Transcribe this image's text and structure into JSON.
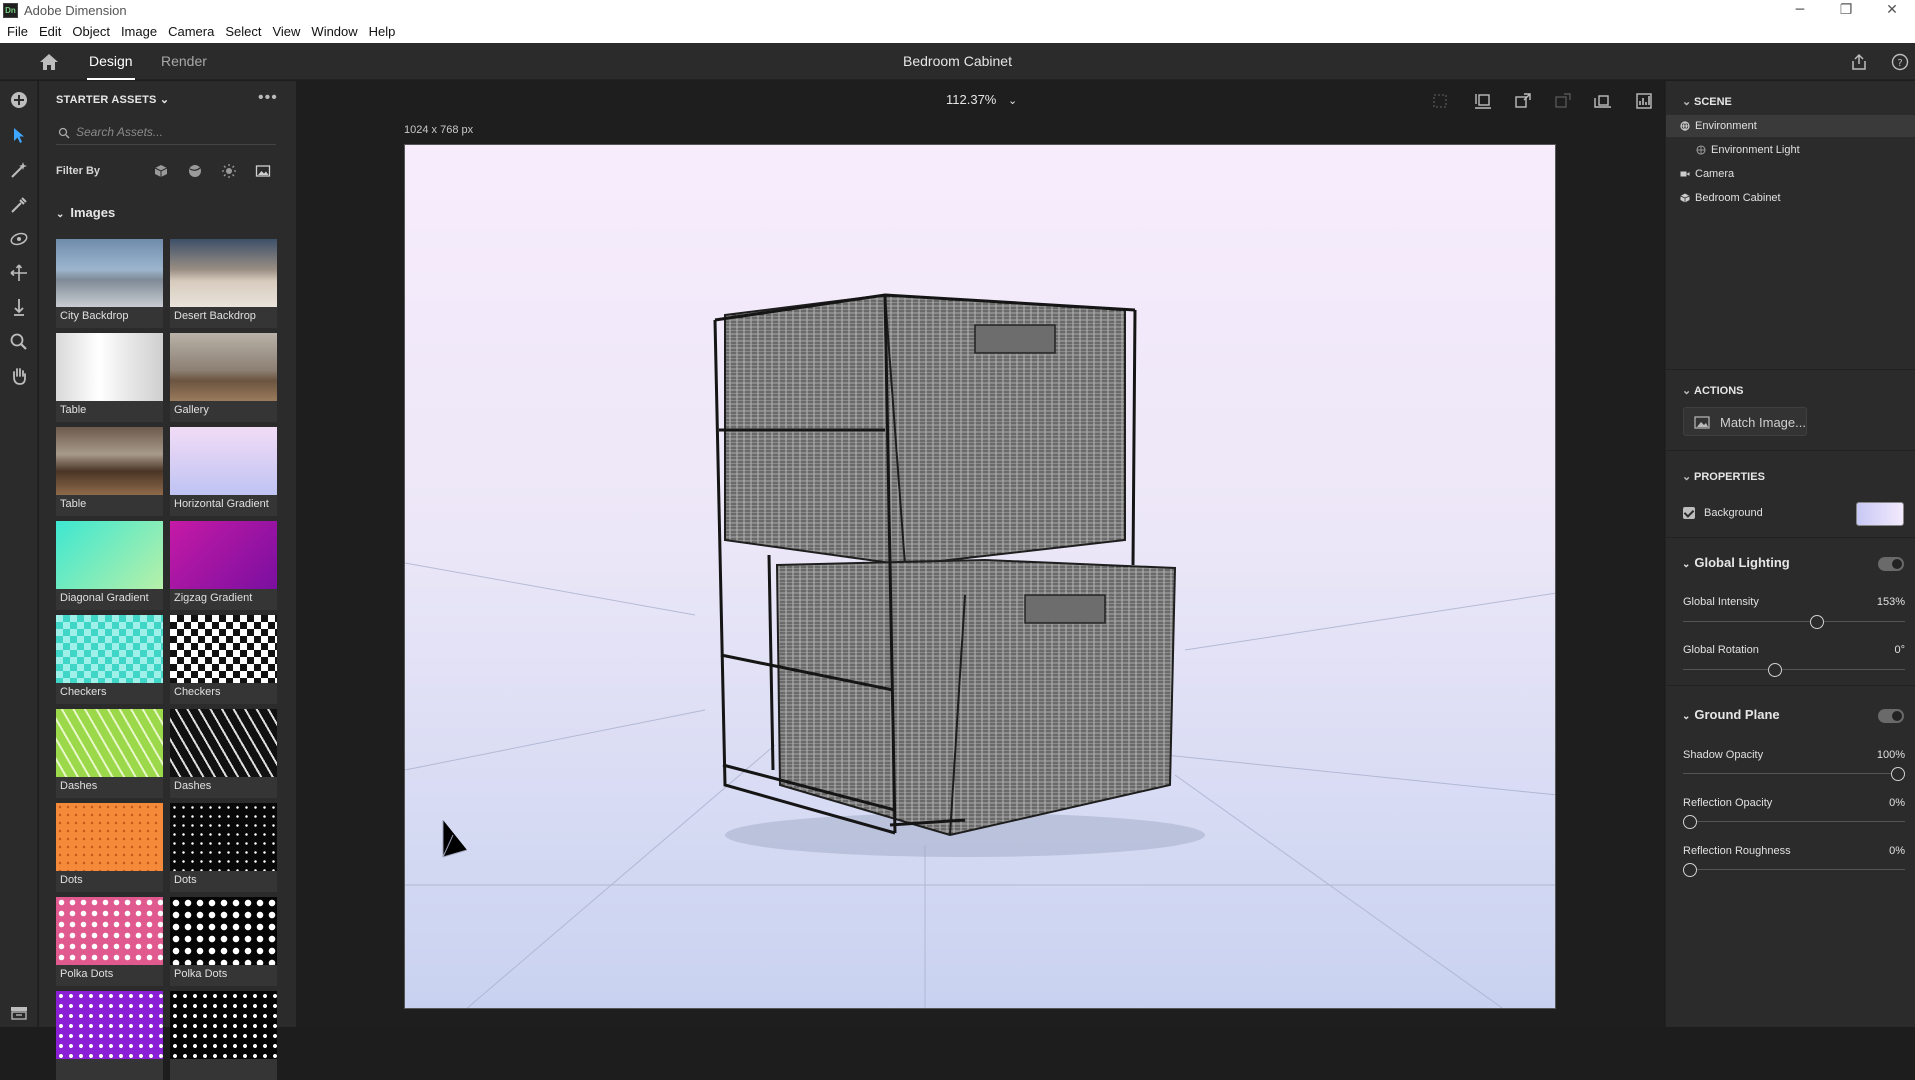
{
  "window": {
    "title": "Adobe Dimension",
    "app_icon_text": "Dn",
    "controls": [
      "─",
      "❐",
      "✕"
    ]
  },
  "menu": [
    "File",
    "Edit",
    "Object",
    "Image",
    "Camera",
    "Select",
    "View",
    "Window",
    "Help"
  ],
  "header": {
    "tabs": [
      "Design",
      "Render"
    ],
    "active_tab": "Design",
    "document_title": "Bedroom Cabinet"
  },
  "assets": {
    "title": "STARTER ASSETS",
    "search_placeholder": "Search Assets...",
    "filter_label": "Filter By",
    "filter_icons": [
      "model-icon",
      "material-icon",
      "light-icon",
      "image-icon"
    ],
    "section": "Images",
    "items": [
      {
        "label": "City Backdrop",
        "thumb": "city"
      },
      {
        "label": "Desert Backdrop",
        "thumb": "desert"
      },
      {
        "label": "Table",
        "thumb": "table1"
      },
      {
        "label": "Gallery",
        "thumb": "gallery"
      },
      {
        "label": "Table",
        "thumb": "table2"
      },
      {
        "label": "Horizontal Gradient",
        "thumb": "hgrad"
      },
      {
        "label": "Diagonal Gradient",
        "thumb": "dgrad"
      },
      {
        "label": "Zigzag Gradient",
        "thumb": "zgrad"
      },
      {
        "label": "Checkers",
        "thumb": "check-teal"
      },
      {
        "label": "Checkers",
        "thumb": "check-bw"
      },
      {
        "label": "Dashes",
        "thumb": "dash-green"
      },
      {
        "label": "Dashes",
        "thumb": "dash-black"
      },
      {
        "label": "Dots",
        "thumb": "dots-orange"
      },
      {
        "label": "Dots",
        "thumb": "dots-black"
      },
      {
        "label": "Polka Dots",
        "thumb": "polka-pink"
      },
      {
        "label": "Polka Dots",
        "thumb": "polka-black"
      },
      {
        "label": "",
        "thumb": "stars-purple"
      },
      {
        "label": "",
        "thumb": "stars-black"
      }
    ]
  },
  "canvas": {
    "zoom": "112.37%",
    "dimensions": "1024 x 768 px"
  },
  "scene": {
    "title": "SCENE",
    "items": [
      {
        "label": "Environment",
        "icon": "environment-icon",
        "selected": true,
        "indent": 0
      },
      {
        "label": "Environment Light",
        "icon": "light-icon",
        "selected": false,
        "indent": 1
      },
      {
        "label": "Camera",
        "icon": "camera-icon",
        "selected": false,
        "indent": 0
      },
      {
        "label": "Bedroom Cabinet",
        "icon": "model-icon",
        "selected": false,
        "indent": 0
      }
    ]
  },
  "actions": {
    "title": "ACTIONS",
    "match_image": "Match Image..."
  },
  "properties": {
    "title": "PROPERTIES",
    "background_label": "Background",
    "background_checked": true,
    "background_colors": [
      "#c7c8f5",
      "#f3eafc"
    ],
    "global_lighting": {
      "title": "Global Lighting",
      "enabled": true,
      "intensity_label": "Global Intensity",
      "intensity_value": "153%",
      "intensity_fraction": 0.61,
      "rotation_label": "Global Rotation",
      "rotation_value": "0°",
      "rotation_fraction": 0.41
    },
    "ground_plane": {
      "title": "Ground Plane",
      "enabled": true,
      "shadow_label": "Shadow Opacity",
      "shadow_value": "100%",
      "shadow_fraction": 1.0,
      "reflection_label": "Reflection Opacity",
      "reflection_value": "0%",
      "reflection_fraction": 0.0,
      "roughness_label": "Reflection Roughness",
      "roughness_value": "0%",
      "roughness_fraction": 0.0
    }
  }
}
